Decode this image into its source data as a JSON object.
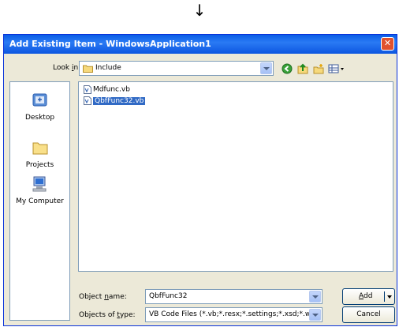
{
  "arrow": "↓",
  "dialog": {
    "title": "Add Existing Item - WindowsApplication1",
    "close": "✕"
  },
  "lookin": {
    "label_pre": "Look ",
    "label_ul": "i",
    "label_post": "n:",
    "value": "Include"
  },
  "places": [
    {
      "label": "Desktop",
      "icon": "desktop-icon"
    },
    {
      "label": "Projects",
      "icon": "folder-icon"
    },
    {
      "label": "My Computer",
      "icon": "computer-icon"
    }
  ],
  "files": [
    {
      "name": "Mdfunc.vb",
      "selected": false
    },
    {
      "name": "QbfFunc32.vb",
      "selected": true
    }
  ],
  "object_name": {
    "label_pre": "Object ",
    "label_ul": "n",
    "label_post": "ame:",
    "value": "QbfFunc32"
  },
  "object_type": {
    "label_pre": "Objects of ",
    "label_ul": "t",
    "label_post": "ype:",
    "value": "VB Code Files (*.vb;*.resx;*.settings;*.xsd;*.wsd"
  },
  "buttons": {
    "add_ul": "A",
    "add_rest": "dd",
    "cancel": "Cancel"
  }
}
